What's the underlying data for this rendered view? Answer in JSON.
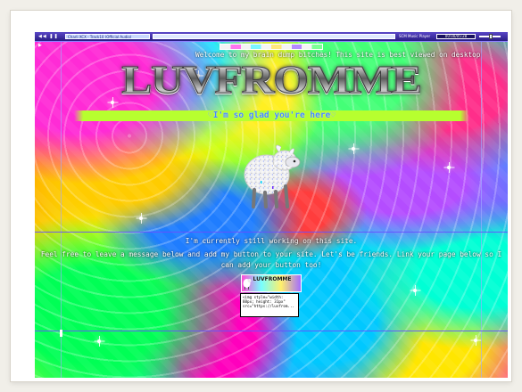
{
  "player": {
    "controls": "◀◀ ❚❚ ▶",
    "track": "Charli XCX - Track10 (Official Audio)",
    "name": "SCM Music Player",
    "time": "00:00/05:28",
    "progress": 0.0,
    "volume": 0.55
  },
  "header": {
    "welcome": "Welcome to my brain dump bitches! This site is best viewed on desktop",
    "logo": "LUVFROMME",
    "glad": "♡I'm so glad you're here♡"
  },
  "content": {
    "working": "I'm currently still working on this site.",
    "message": "Feel free to leave a message below and add my button to your site. Let's be friends. Link your page below so I can add your button too!",
    "button_text": "LUVFROMME",
    "code": "<img style=\"width:\n88px; height: 31px\"\nsrc=\"https://luvfrom..."
  },
  "colors": {
    "player": "#2a1d84",
    "accent": "#b7ff2f",
    "text": "#ffffff",
    "logo": "#9a9a9a"
  }
}
